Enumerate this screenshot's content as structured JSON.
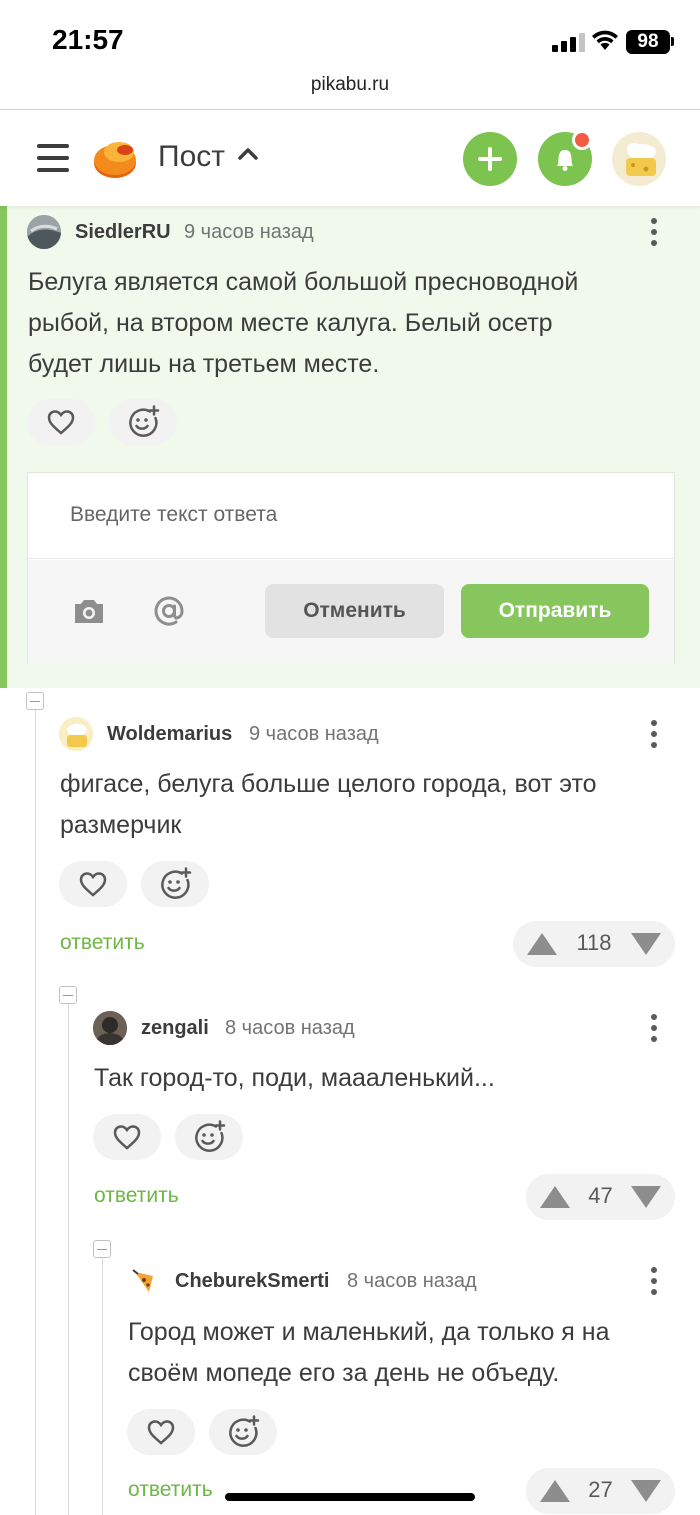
{
  "status_bar": {
    "time": "21:57",
    "battery": "98"
  },
  "browser": {
    "url": "pikabu.ru"
  },
  "header": {
    "title": "Пост"
  },
  "colors": {
    "accent": "#86c65c",
    "link": "#6db743",
    "highlight_bg": "#f1f9ec",
    "notification": "#f25c40"
  },
  "comments": [
    {
      "user": "SiedlerRU",
      "time": "9 часов назад",
      "text_lines": [
        "Белуга является самой большой пресноводной",
        "рыбой, на втором месте калуга. Белый осетр",
        "будет лишь на третьем месте."
      ]
    },
    {
      "user": "Woldemarius",
      "time": "9 часов назад",
      "text_lines": [
        "фигасе, белуга больше целого города, вот это",
        "размерчик"
      ],
      "reply_label": "ответить",
      "rating": "118"
    },
    {
      "user": "zengali",
      "time": "8 часов назад",
      "text_lines": [
        "Так город-то, поди, маааленький..."
      ],
      "reply_label": "ответить",
      "rating": "47"
    },
    {
      "user": "CheburekSmerti",
      "time": "8 часов назад",
      "text_lines": [
        "Город может и маленький, да только я на",
        "своём мопеде его за день не объеду."
      ],
      "reply_label": "ответить",
      "rating": "27"
    }
  ],
  "reply_form": {
    "placeholder": "Введите текст ответа",
    "cancel_label": "Отменить",
    "send_label": "Отправить"
  },
  "icons": [
    "hamburger-icon",
    "pikabu-logo-icon",
    "chevron-up-icon",
    "plus-icon",
    "bell-icon",
    "like-icon",
    "emoji-add-icon",
    "camera-icon",
    "mention-icon",
    "more-icon",
    "upvote-icon",
    "downvote-icon"
  ]
}
